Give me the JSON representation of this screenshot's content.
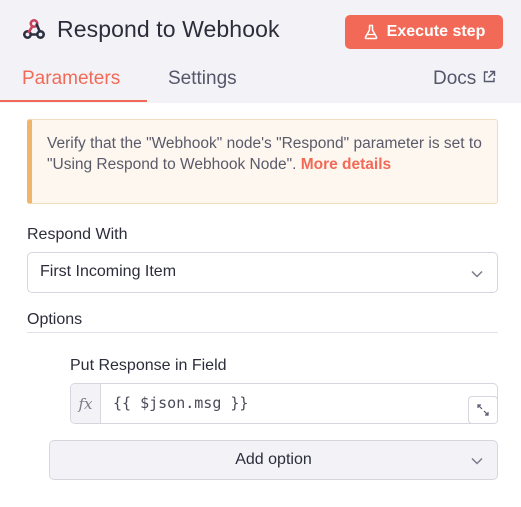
{
  "header": {
    "title": "Respond to Webhook",
    "node_icon": "webhook-icon",
    "execute_button": {
      "label": "Execute step",
      "icon": "flask-icon"
    }
  },
  "tabs": [
    {
      "label": "Parameters",
      "active": true
    },
    {
      "label": "Settings",
      "active": false
    }
  ],
  "docs": {
    "label": "Docs",
    "icon": "external-link-icon"
  },
  "notice": {
    "text": "Verify that the \"Webhook\" node's \"Respond\" parameter is set to \"Using Respond to Webhook Node\". ",
    "link": "More details"
  },
  "respond_with": {
    "label": "Respond With",
    "value": "First Incoming Item"
  },
  "options": {
    "label": "Options",
    "put_response": {
      "label": "Put Response in Field",
      "fx": "fx",
      "value": "{{ $json.msg }}"
    },
    "add_option_label": "Add option"
  },
  "colors": {
    "accent": "#f26a57",
    "warning_border": "#f1b46b",
    "warning_bg": "#fdf7ef"
  }
}
